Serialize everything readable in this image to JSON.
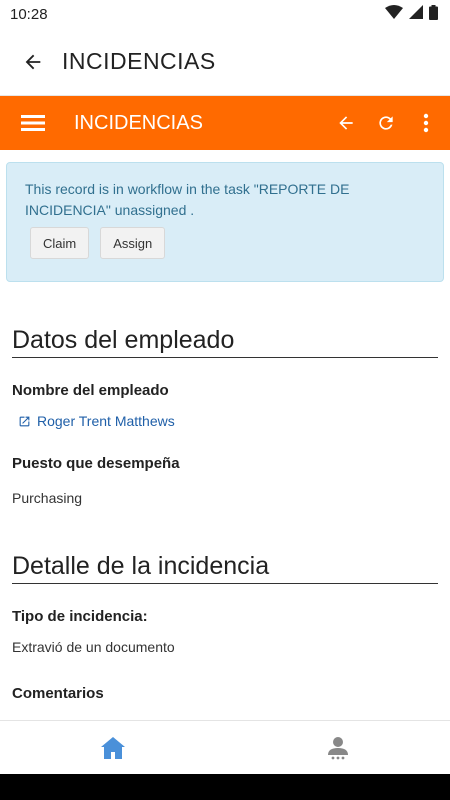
{
  "status_bar": {
    "time": "10:28"
  },
  "app_bar": {
    "title": "INCIDENCIAS"
  },
  "toolbar": {
    "title": "INCIDENCIAS"
  },
  "alert": {
    "message": "This record is in workflow in the task \"REPORTE DE INCIDENCIA\" unassigned .",
    "claim_label": "Claim",
    "assign_label": "Assign"
  },
  "section_employee": {
    "title": "Datos del empleado",
    "name_label": "Nombre del empleado",
    "name_value": "Roger Trent Matthews",
    "position_label": "Puesto que desempeña",
    "position_value": "Purchasing"
  },
  "section_incident": {
    "title": "Detalle de la incidencia",
    "type_label": "Tipo de incidencia:",
    "type_value": "Extravió de un documento",
    "comments_label": "Comentarios"
  },
  "colors": {
    "accent": "#ff6a00",
    "alert_bg": "#d9edf7",
    "alert_text": "#31708f",
    "link": "#1f5fa8",
    "nav_active": "#4a90d9",
    "nav_inactive": "#888888"
  }
}
